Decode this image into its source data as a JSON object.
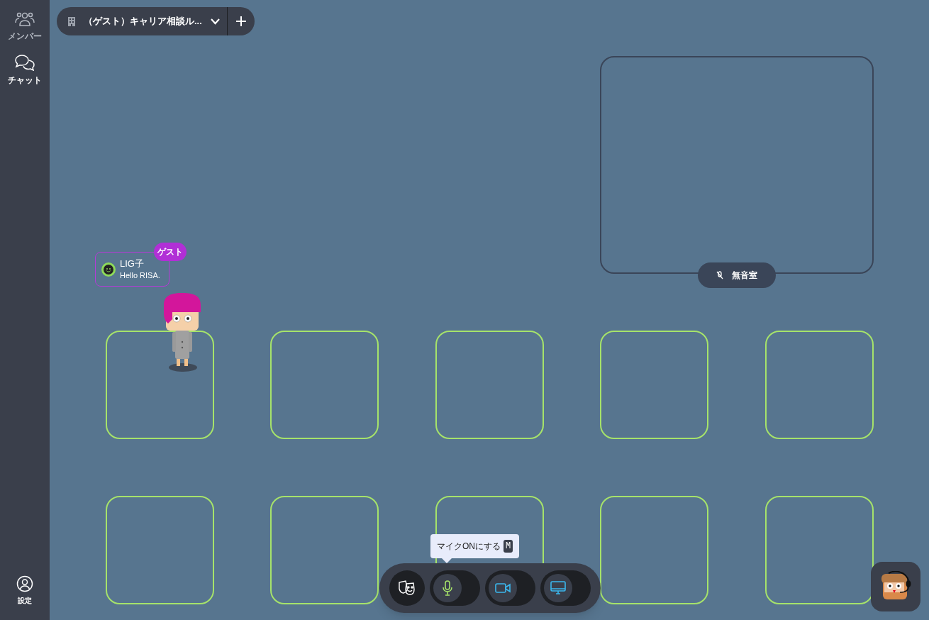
{
  "sidebar": {
    "items": [
      {
        "kind": "members",
        "label": "メンバー",
        "selected": false
      },
      {
        "kind": "chat",
        "label": "チャット",
        "selected": true
      }
    ],
    "settings": {
      "label": "設定"
    }
  },
  "room_selector": {
    "label": "（ゲスト）キャリア相談ル..."
  },
  "zones": [
    {
      "kind": "room",
      "label": "無音室"
    },
    {
      "kind": "tile"
    },
    {
      "kind": "tile"
    },
    {
      "kind": "tile"
    },
    {
      "kind": "tile"
    },
    {
      "kind": "tile"
    },
    {
      "kind": "tile"
    },
    {
      "kind": "tile"
    },
    {
      "kind": "tile"
    },
    {
      "kind": "tile"
    },
    {
      "kind": "tile"
    }
  ],
  "user": {
    "name": "LIG子",
    "status": "Hello RISA.",
    "badge": "ゲスト",
    "color": "#8edb5a"
  },
  "tooltip": {
    "text": "マイクONにする",
    "key": "M"
  },
  "toolbar": [
    {
      "kind": "reaction"
    },
    {
      "kind": "mic",
      "on": false
    },
    {
      "kind": "camera",
      "on": false
    },
    {
      "kind": "screen",
      "on": false
    }
  ]
}
